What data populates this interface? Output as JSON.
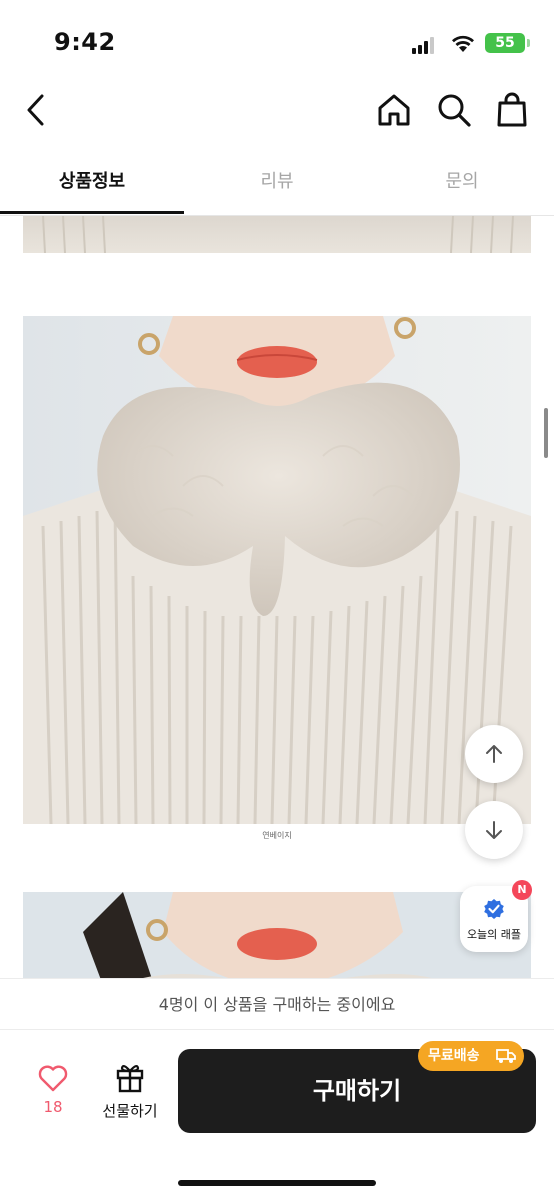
{
  "status_bar": {
    "time": "9:42",
    "battery": "55"
  },
  "nav": {
    "back_icon": "chevron-left-icon",
    "home_icon": "home-icon",
    "search_icon": "search-icon",
    "bag_icon": "shopping-bag-icon"
  },
  "tabs": [
    {
      "label": "상품정보",
      "active": true
    },
    {
      "label": "리뷰",
      "active": false
    },
    {
      "label": "문의",
      "active": false
    }
  ],
  "content": {
    "image_caption": "연베이지"
  },
  "floating": {
    "up_icon": "arrow-up-icon",
    "down_icon": "arrow-down-icon",
    "raffle_label": "오늘의 래플",
    "raffle_badge": "N"
  },
  "notice": {
    "text": "4명이 이 상품을 구매하는 중이에요"
  },
  "bottom_bar": {
    "like_count": "18",
    "gift_label": "선물하기",
    "buy_label": "구매하기",
    "free_shipping_label": "무료배송"
  },
  "colors": {
    "accent_red": "#f05a6e",
    "badge_red": "#f4475a",
    "free_ship_orange": "#f5a623",
    "buy_button": "#1d1d1d",
    "battery_green": "#44c24a",
    "raffle_blue": "#2f6fe0"
  }
}
